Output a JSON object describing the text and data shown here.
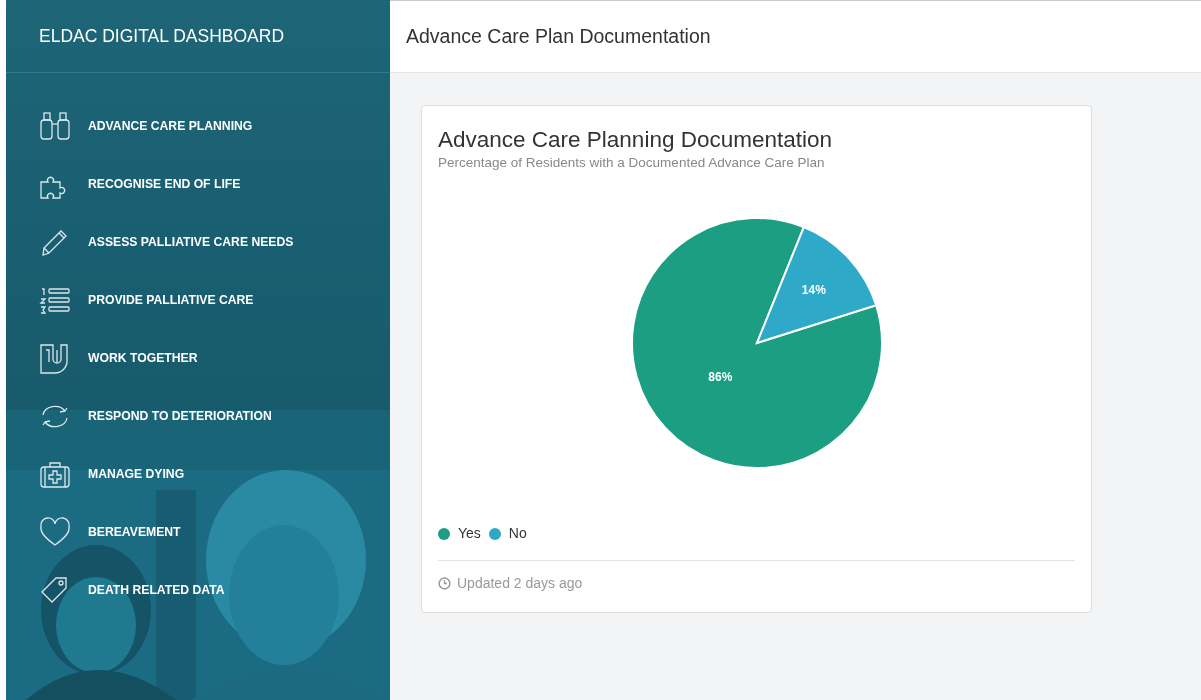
{
  "sidebar": {
    "title": "ELDAC DIGITAL DASHBOARD",
    "items": [
      {
        "label": "ADVANCE CARE PLANNING"
      },
      {
        "label": "RECOGNISE END OF LIFE"
      },
      {
        "label": "ASSESS PALLIATIVE CARE NEEDS"
      },
      {
        "label": "PROVIDE PALLIATIVE CARE"
      },
      {
        "label": "WORK TOGETHER"
      },
      {
        "label": "RESPOND TO DETERIORATION"
      },
      {
        "label": "MANAGE DYING"
      },
      {
        "label": "BEREAVEMENT"
      },
      {
        "label": "DEATH RELATED DATA"
      }
    ]
  },
  "header": {
    "title": "Advance Care Plan Documentation"
  },
  "card": {
    "title": "Advance Care Planning Documentation",
    "subtitle": "Percentage of Residents with a Documented Advance Care Plan",
    "chart_data": {
      "type": "pie",
      "categories": [
        "Yes",
        "No"
      ],
      "values": [
        86,
        14
      ],
      "colors": [
        "#1b9e82",
        "#2eaac8"
      ],
      "value_labels": [
        "86%",
        "14%"
      ]
    },
    "footer": "Updated 2 days ago"
  }
}
